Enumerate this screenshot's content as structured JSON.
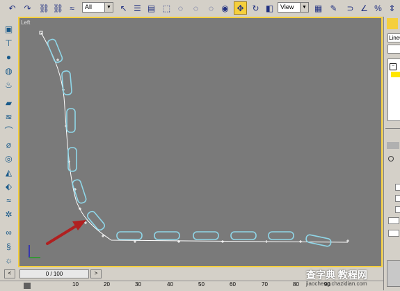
{
  "toolbar": {
    "filter_select": "All",
    "coord_select": "View"
  },
  "viewport": {
    "label": "Left"
  },
  "right_panel": {
    "name_field": "LineO"
  },
  "timeline": {
    "frame_display": "0 / 100",
    "ticks": [
      "10",
      "20",
      "30",
      "40",
      "50",
      "60",
      "70",
      "80",
      "90"
    ]
  },
  "watermark": {
    "main": "查字典 教程网",
    "sub": "jiaocheng.chazidian.com"
  },
  "colors": {
    "viewport_bg": "#7a7a7a",
    "active_border": "#f5cf3c",
    "spline": "#ffffff",
    "cloned_objects": "#8fd6e8",
    "annotation_arrow": "#b02020"
  }
}
